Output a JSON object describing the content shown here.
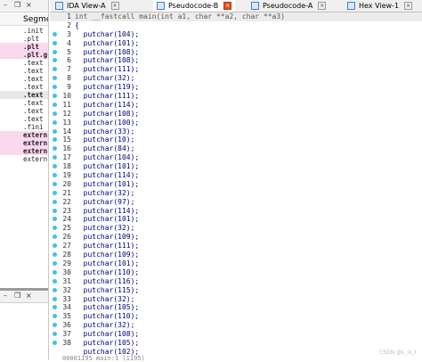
{
  "tabs": [
    {
      "label": "IDA View-A",
      "close": "×",
      "active": false
    },
    {
      "label": "Pseudocode-B",
      "close": "×",
      "active": true
    },
    {
      "label": "Pseudocode-A",
      "close": "×",
      "active": false
    },
    {
      "label": "Hex View-1",
      "close": "×",
      "active": false
    }
  ],
  "window_controls": {
    "minimize": "–",
    "restore": "❐",
    "close": "×"
  },
  "segments_panel": {
    "title": "Segme",
    "rows": [
      ".init",
      ".plt",
      ".plt",
      ".plt.g",
      ".text",
      ".text",
      ".text",
      ".text",
      ".text",
      ".text",
      ".text",
      ".text",
      ".fini",
      "extern",
      "extern",
      "extern",
      "extern"
    ]
  },
  "code": {
    "lines": [
      {
        "n": "1",
        "text": "int __fastcall main(int a1, char **a2, char **a3)",
        "dot": false
      },
      {
        "n": "2",
        "text": "{",
        "dot": false
      },
      {
        "n": "3",
        "text": "  putchar(104);",
        "dot": true
      },
      {
        "n": "4",
        "text": "  putchar(101);",
        "dot": true
      },
      {
        "n": "5",
        "text": "  putchar(108);",
        "dot": true
      },
      {
        "n": "6",
        "text": "  putchar(108);",
        "dot": true
      },
      {
        "n": "7",
        "text": "  putchar(111);",
        "dot": true
      },
      {
        "n": "8",
        "text": "  putchar(32);",
        "dot": true
      },
      {
        "n": "9",
        "text": "  putchar(119);",
        "dot": true
      },
      {
        "n": "10",
        "text": "  putchar(111);",
        "dot": true
      },
      {
        "n": "11",
        "text": "  putchar(114);",
        "dot": true
      },
      {
        "n": "12",
        "text": "  putchar(108);",
        "dot": true
      },
      {
        "n": "13",
        "text": "  putchar(100);",
        "dot": true
      },
      {
        "n": "14",
        "text": "  putchar(33);",
        "dot": true
      },
      {
        "n": "15",
        "text": "  putchar(10);",
        "dot": true
      },
      {
        "n": "16",
        "text": "  putchar(84);",
        "dot": true
      },
      {
        "n": "17",
        "text": "  putchar(104);",
        "dot": true
      },
      {
        "n": "18",
        "text": "  putchar(101);",
        "dot": true
      },
      {
        "n": "19",
        "text": "  putchar(114);",
        "dot": true
      },
      {
        "n": "20",
        "text": "  putchar(101);",
        "dot": true
      },
      {
        "n": "21",
        "text": "  putchar(32);",
        "dot": true
      },
      {
        "n": "22",
        "text": "  putchar(97);",
        "dot": true
      },
      {
        "n": "23",
        "text": "  putchar(114);",
        "dot": true
      },
      {
        "n": "24",
        "text": "  putchar(101);",
        "dot": true
      },
      {
        "n": "25",
        "text": "  putchar(32);",
        "dot": true
      },
      {
        "n": "26",
        "text": "  putchar(109);",
        "dot": true
      },
      {
        "n": "27",
        "text": "  putchar(111);",
        "dot": true
      },
      {
        "n": "28",
        "text": "  putchar(109);",
        "dot": true
      },
      {
        "n": "29",
        "text": "  putchar(101);",
        "dot": true
      },
      {
        "n": "30",
        "text": "  putchar(110);",
        "dot": true
      },
      {
        "n": "31",
        "text": "  putchar(116);",
        "dot": true
      },
      {
        "n": "32",
        "text": "  putchar(115);",
        "dot": true
      },
      {
        "n": "33",
        "text": "  putchar(32);",
        "dot": true
      },
      {
        "n": "34",
        "text": "  putchar(105);",
        "dot": true
      },
      {
        "n": "35",
        "text": "  putchar(110);",
        "dot": true
      },
      {
        "n": "36",
        "text": "  putchar(32);",
        "dot": true
      },
      {
        "n": "37",
        "text": "  putchar(108);",
        "dot": true
      },
      {
        "n": "38",
        "text": "  putchar(105);",
        "dot": true
      },
      {
        "n": "",
        "text": "  putchar(102);",
        "dot": false
      }
    ]
  },
  "status": {
    "text": "00001195 main:1 (1195)"
  },
  "watermark": "CSDN @L_ix_t",
  "colors": {
    "dot": "#45c0e8",
    "code_text": "#000080",
    "pink_row": "#fbd8ee",
    "active_close": "#e0501c"
  }
}
